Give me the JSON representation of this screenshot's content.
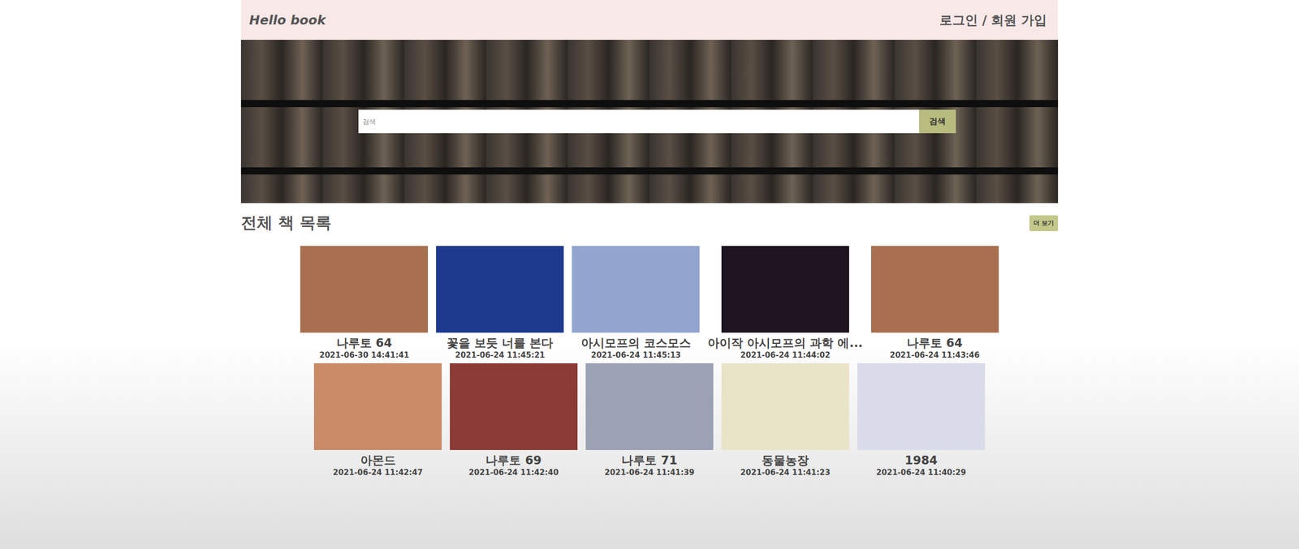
{
  "header": {
    "logo": "Hello book",
    "auth_link": "로그인 / 회원 가입"
  },
  "search": {
    "placeholder": "검색",
    "button": "검색"
  },
  "section": {
    "title": "전체 책 목록",
    "more_button": "더 보기"
  },
  "books": [
    {
      "title": "나루토 64",
      "date": "2021-06-30 14:41:41",
      "color": "#a8704e"
    },
    {
      "title": "꽃을 보듯 너를 본다",
      "date": "2021-06-24 11:45:21",
      "color": "#1d3a8e"
    },
    {
      "title": "아시모프의 코스모스",
      "date": "2021-06-24 11:45:13",
      "color": "#93a5cf"
    },
    {
      "title": "아이작 아시모프의 과학 에...",
      "date": "2021-06-24 11:44:02",
      "color": "#1e1420"
    },
    {
      "title": "나루토 64",
      "date": "2021-06-24 11:43:46",
      "color": "#a8704e"
    },
    {
      "title": "아몬드",
      "date": "2021-06-24 11:42:47",
      "color": "#c98a66"
    },
    {
      "title": "나루토 69",
      "date": "2021-06-24 11:42:40",
      "color": "#8c3b36"
    },
    {
      "title": "나루토 71",
      "date": "2021-06-24 11:41:39",
      "color": "#9aa2b4"
    },
    {
      "title": "동물농장",
      "date": "2021-06-24 11:41:23",
      "color": "#e9e3c8"
    },
    {
      "title": "1984",
      "date": "2021-06-24 11:40:29",
      "color": "#d9dbe8"
    }
  ]
}
